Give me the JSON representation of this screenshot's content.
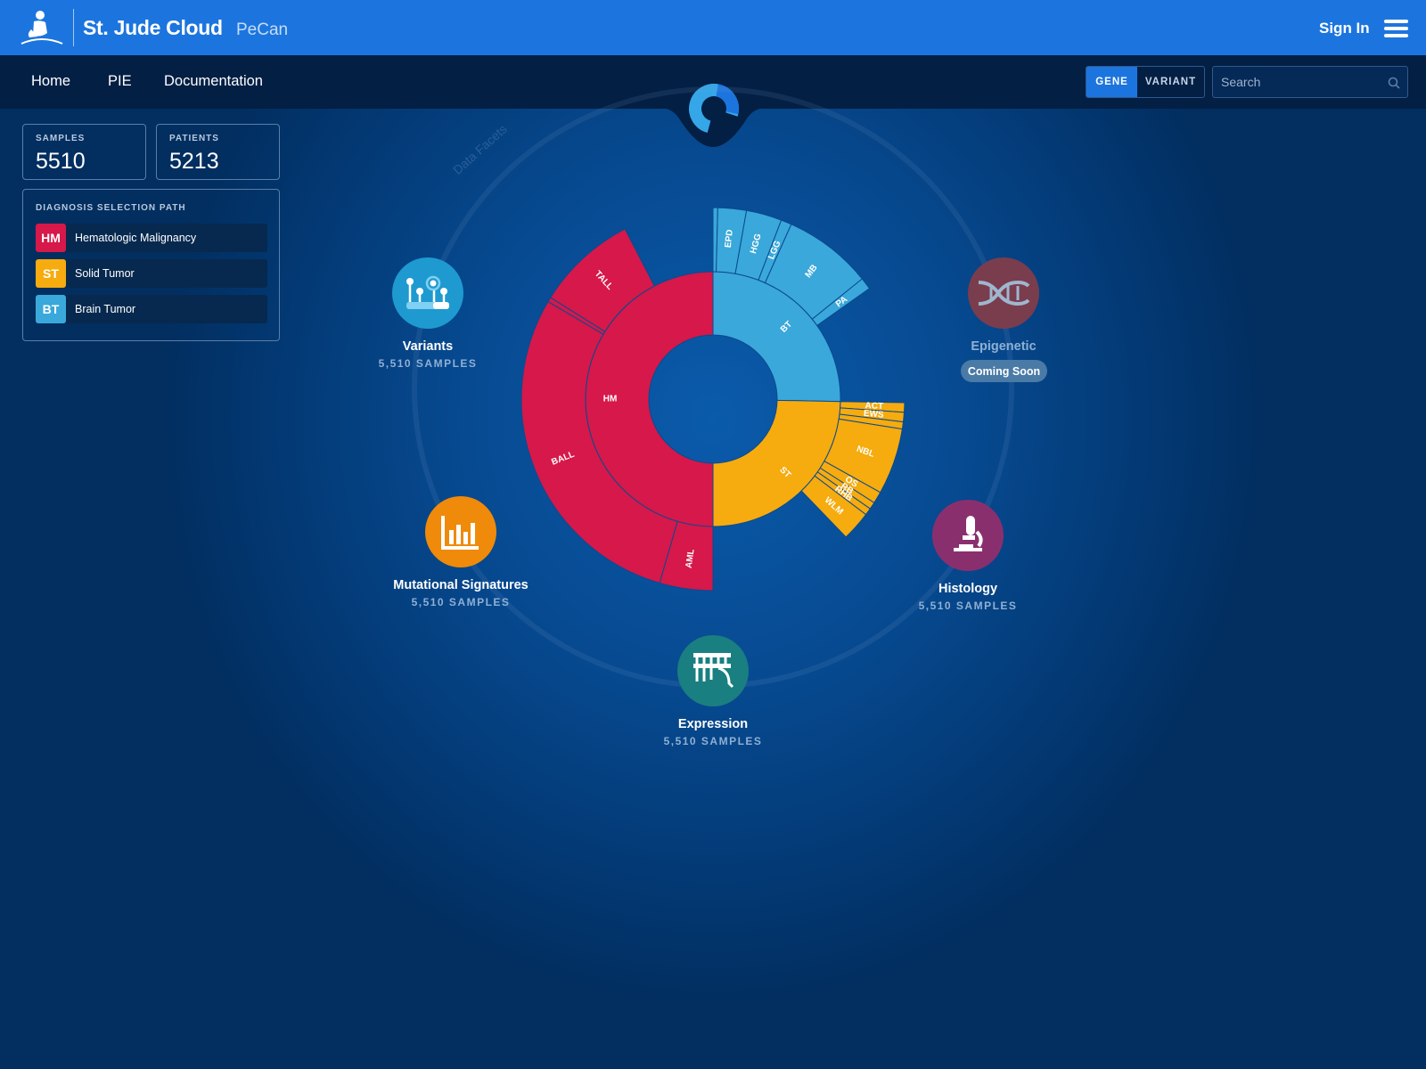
{
  "header": {
    "brand": "St. Jude Cloud",
    "product": "PeCan",
    "sign_in": "Sign In"
  },
  "nav": {
    "items": [
      "Home",
      "PIE",
      "Documentation"
    ],
    "toggle": [
      "GENE",
      "VARIANT"
    ],
    "toggle_selected": "GENE",
    "search_placeholder": "Search"
  },
  "stats": {
    "samples_label": "SAMPLES",
    "samples_value": "5510",
    "patients_label": "PATIENTS",
    "patients_value": "5213"
  },
  "selection_path": {
    "title": "DIAGNOSIS SELECTION PATH",
    "items": [
      {
        "code": "HM",
        "name": "Hematologic Malignancy",
        "color": "#d6184a"
      },
      {
        "code": "ST",
        "name": "Solid Tumor",
        "color": "#f6ab0e"
      },
      {
        "code": "BT",
        "name": "Brain Tumor",
        "color": "#3aa8da"
      }
    ]
  },
  "facets": {
    "arc_label": "Data Facets",
    "variants": {
      "title": "Variants",
      "samples": "5,510 SAMPLES",
      "color": "#1e9ad0",
      "icon": "variants-icon"
    },
    "epigenetic": {
      "title": "Epigenetic",
      "badge": "Coming Soon",
      "color": "#7a3d4d",
      "icon": "dna-icon"
    },
    "mutational": {
      "title": "Mutational Signatures",
      "samples": "5,510 SAMPLES",
      "color": "#f08a0a",
      "icon": "bar-chart-icon"
    },
    "histology": {
      "title": "Histology",
      "samples": "5,510 SAMPLES",
      "color": "#8a2f6e",
      "icon": "microscope-icon"
    },
    "expression": {
      "title": "Expression",
      "samples": "5,510 SAMPLES",
      "color": "#1a7f80",
      "icon": "expression-icon"
    }
  },
  "chart_data": {
    "type": "sunburst",
    "colors": {
      "HM": "#d6184a",
      "ST": "#f6ab0e",
      "BT": "#3aa8da"
    },
    "inner": [
      {
        "label": "HM",
        "share": 0.5
      },
      {
        "label": "BT",
        "share": 0.253
      },
      {
        "label": "ST",
        "share": 0.247
      }
    ],
    "outer": [
      {
        "parent": "HM",
        "label": "AML",
        "share": 0.045,
        "pushed": true
      },
      {
        "parent": "HM",
        "label": "BALL",
        "share": 0.29,
        "pushed": true
      },
      {
        "parent": "HM",
        "label": "",
        "share": 0.004,
        "pushed": true
      },
      {
        "parent": "HM",
        "label": "TALL",
        "share": 0.085,
        "pushed": true
      },
      {
        "parent": "HM",
        "label": "",
        "share": 0.076,
        "pushed": false
      },
      {
        "parent": "BT",
        "label": "",
        "share": 0.004,
        "pushed": true
      },
      {
        "parent": "BT",
        "label": "EPD",
        "share": 0.024,
        "pushed": true
      },
      {
        "parent": "BT",
        "label": "HGG",
        "share": 0.03,
        "pushed": true
      },
      {
        "parent": "BT",
        "label": "LGG",
        "share": 0.009,
        "pushed": true
      },
      {
        "parent": "BT",
        "label": "MB",
        "share": 0.075,
        "pushed": true
      },
      {
        "parent": "BT",
        "label": "PA",
        "share": 0.01,
        "pushed": true
      },
      {
        "parent": "BT",
        "label": "",
        "share": 0.101,
        "pushed": false
      },
      {
        "parent": "ST",
        "label": "ACT",
        "share": 0.008,
        "pushed": true
      },
      {
        "parent": "ST",
        "label": "EWS",
        "share": 0.008,
        "pushed": true
      },
      {
        "parent": "ST",
        "label": "",
        "share": 0.006,
        "pushed": true
      },
      {
        "parent": "ST",
        "label": "NBL",
        "share": 0.056,
        "pushed": true
      },
      {
        "parent": "ST",
        "label": "OS",
        "share": 0.01,
        "pushed": true
      },
      {
        "parent": "ST",
        "label": "RB",
        "share": 0.006,
        "pushed": true
      },
      {
        "parent": "ST",
        "label": "RHB",
        "share": 0.006,
        "pushed": true
      },
      {
        "parent": "ST",
        "label": "WLM",
        "share": 0.025,
        "pushed": true
      },
      {
        "parent": "ST",
        "label": "",
        "share": 0.122,
        "pushed": false
      }
    ]
  }
}
